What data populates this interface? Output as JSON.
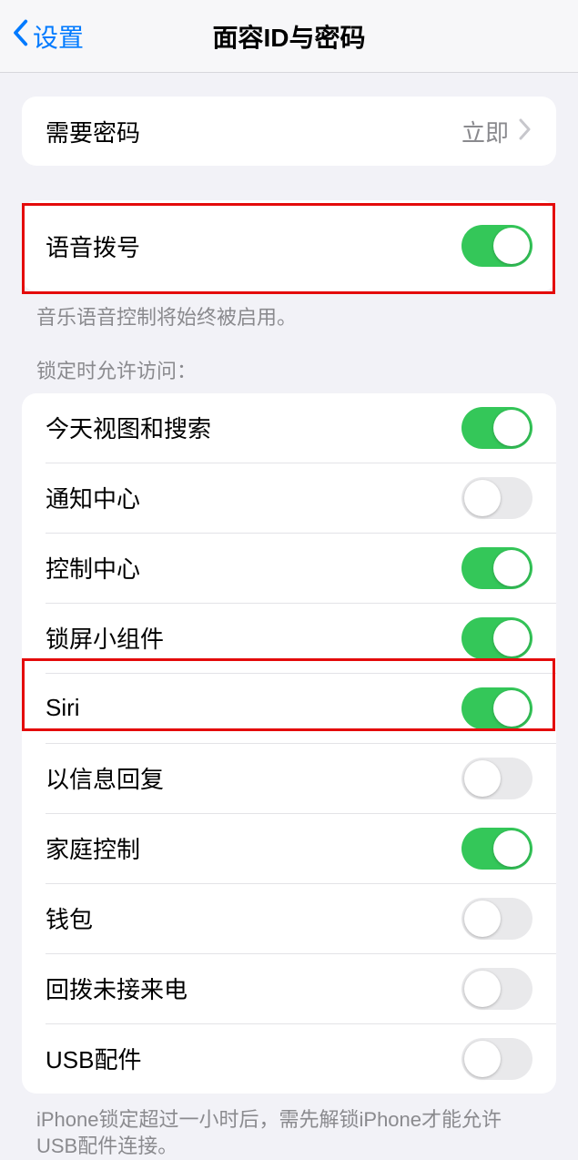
{
  "nav": {
    "back": "设置",
    "title": "面容ID与密码"
  },
  "passcode": {
    "label": "需要密码",
    "value": "立即"
  },
  "voiceDial": {
    "label": "语音拨号",
    "on": true,
    "note": "音乐语音控制将始终被启用。"
  },
  "lockedHeader": "锁定时允许访问：",
  "locked": [
    {
      "label": "今天视图和搜索",
      "on": true
    },
    {
      "label": "通知中心",
      "on": false
    },
    {
      "label": "控制中心",
      "on": true
    },
    {
      "label": "锁屏小组件",
      "on": true
    },
    {
      "label": "Siri",
      "on": true
    },
    {
      "label": "以信息回复",
      "on": false
    },
    {
      "label": "家庭控制",
      "on": true
    },
    {
      "label": "钱包",
      "on": false
    },
    {
      "label": "回拨未接来电",
      "on": false
    },
    {
      "label": "USB配件",
      "on": false
    }
  ],
  "usbNote": "iPhone锁定超过一小时后，需先解锁iPhone才能允许USB配件连接。"
}
